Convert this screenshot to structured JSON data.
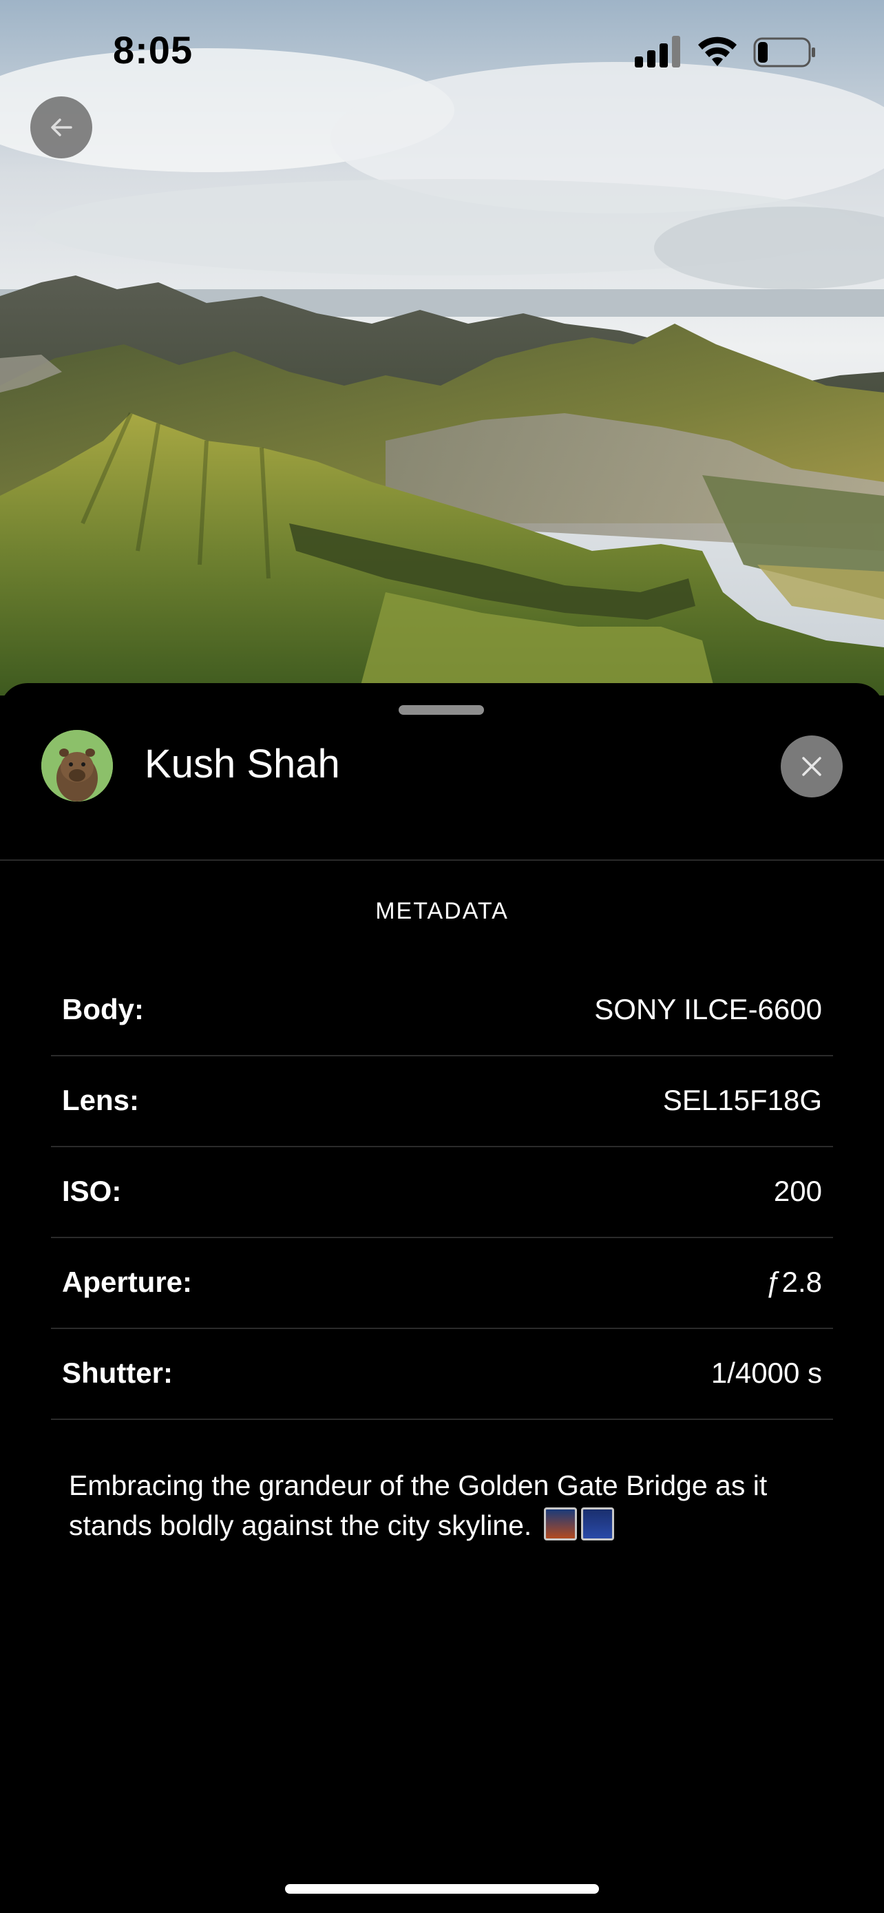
{
  "status_bar": {
    "time": "8:05",
    "signal_icon": "cellular-signal-icon",
    "wifi_icon": "wifi-icon",
    "battery_icon": "battery-low-icon",
    "battery_level": 0.15
  },
  "photo": {
    "icon": "landscape-photo"
  },
  "navigation": {
    "back_icon": "arrow-left-icon"
  },
  "sheet": {
    "user": {
      "name": "Kush Shah",
      "avatar_icon": "capybara-avatar"
    },
    "close_icon": "close-icon",
    "section_title": "METADATA",
    "metadata": [
      {
        "label": "Body:",
        "value": "SONY ILCE-6600"
      },
      {
        "label": "Lens:",
        "value": "SEL15F18G"
      },
      {
        "label": "ISO:",
        "value": "200"
      },
      {
        "label": "Aperture:",
        "value": "ƒ2.8"
      },
      {
        "label": "Shutter:",
        "value": "1/4000 s"
      }
    ],
    "caption": {
      "line1": "Embracing the grandeur of the Golden Gate Bridge as it",
      "line2": "stands boldly against the city skyline.",
      "emojis": [
        "🌉",
        "🌃"
      ]
    }
  },
  "colors": {
    "sheet_background": "#000000",
    "button_gray": "#7a7a7a",
    "divider": "#2b2b2b"
  }
}
